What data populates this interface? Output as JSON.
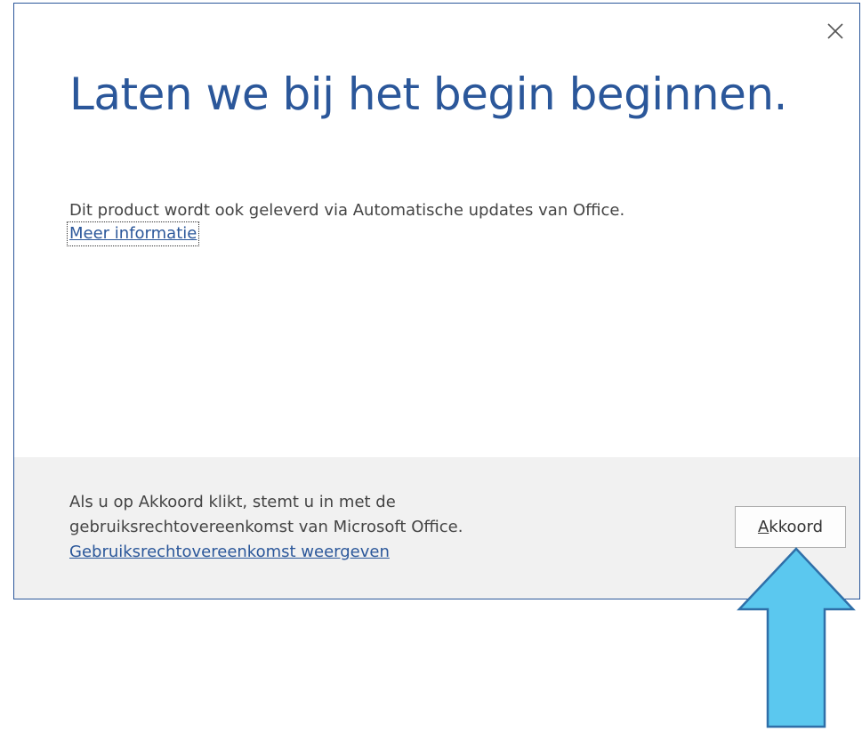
{
  "dialog": {
    "title": "Laten we bij het begin beginnen.",
    "body_text": "Dit product wordt ook geleverd via Automatische updates van Office.",
    "more_info_link": "Meer informatie"
  },
  "footer": {
    "agreement_line1": "Als u op Akkoord klikt, stemt u in met de",
    "agreement_line2": "gebruiksrechtovereenkomst van Microsoft Office.",
    "agreement_link": "Gebruiksrechtovereenkomst weergeven",
    "accept_mnemonic": "A",
    "accept_rest": "kkoord"
  },
  "icons": {
    "close": "close-icon",
    "arrow": "arrow-up-icon"
  },
  "colors": {
    "accent": "#2b579a",
    "footer_bg": "#f1f1f1",
    "arrow_fill": "#5bc8ef",
    "arrow_stroke": "#2f6fa8"
  }
}
